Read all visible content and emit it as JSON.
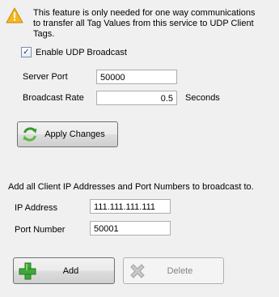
{
  "notice": {
    "line1": "This feature is only needed for one way communications",
    "line2": "to transfer all Tag Values from this service to UDP Client Tags."
  },
  "enable_broadcast": {
    "label": "Enable UDP Broadcast",
    "checked": true
  },
  "server_port": {
    "label": "Server Port",
    "value": "50000"
  },
  "broadcast_rate": {
    "label": "Broadcast Rate",
    "value": "0.5",
    "unit": "Seconds"
  },
  "apply_button": {
    "label": "Apply Changes"
  },
  "clients_heading": "Add all Client IP Addresses and Port Numbers to broadcast to.",
  "ip_address": {
    "label": "IP Address",
    "value": "111.111.111.111"
  },
  "port_number": {
    "label": "Port Number",
    "value": "50001"
  },
  "add_button": {
    "label": "Add"
  },
  "delete_button": {
    "label": "Delete",
    "enabled": false
  }
}
